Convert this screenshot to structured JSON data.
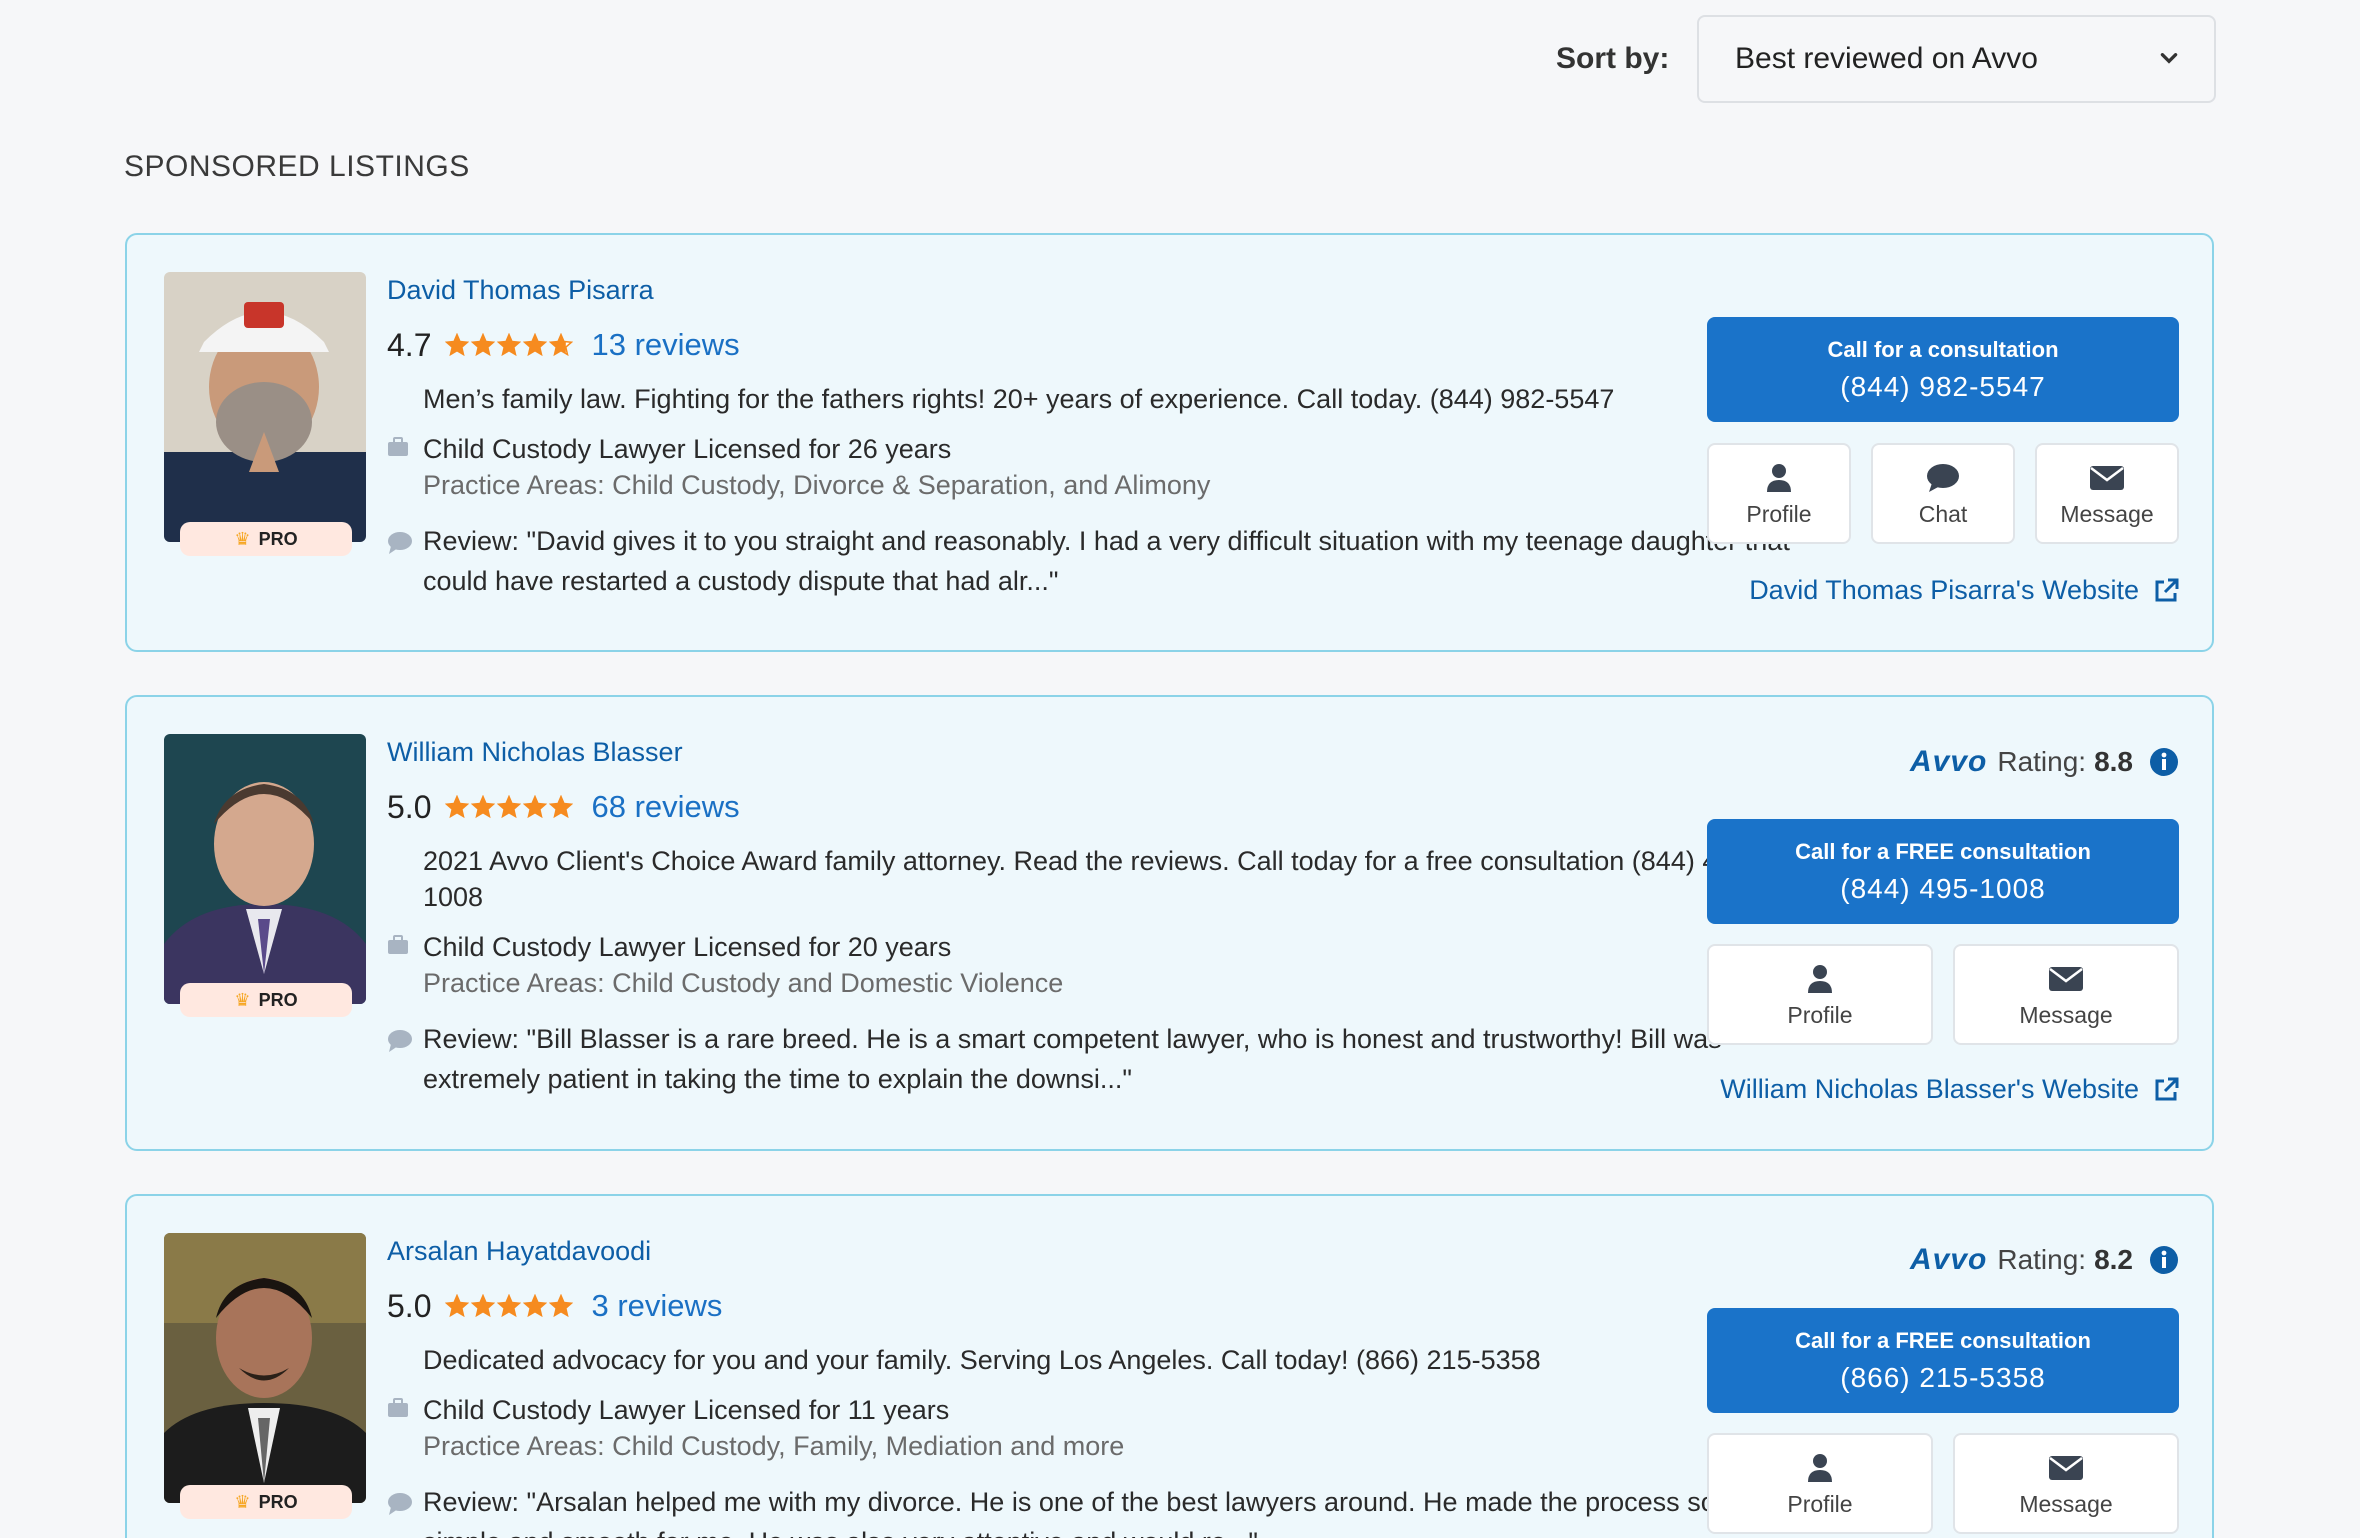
{
  "sort": {
    "label": "Sort by:",
    "selected": "Best reviewed on Avvo"
  },
  "section_title": "SPONSORED LISTINGS",
  "colors": {
    "brand_blue": "#1a73c9",
    "link_blue": "#0d5ea6",
    "card_bg": "#eef8fc",
    "card_border": "#8bd3e8",
    "star": "#f68b1f"
  },
  "listings": [
    {
      "name": "David Thomas Pisarra",
      "score": "4.7",
      "stars": 4.7,
      "reviews": "13 reviews",
      "badge": "PRO",
      "tagline": "Men’s family law. Fighting for the fathers rights! 20+ years of experience. Call today. (844) 982-5547",
      "license": "Child Custody Lawyer Licensed for 26 years",
      "practice": "Practice Areas: Child Custody, Divorce & Separation, and Alimony",
      "review": "Review: \"David gives it to you straight and reasonably. I had a very difficult situation with my teenage daughter that could have restarted a custody dispute that had alr...\"",
      "call_title": "Call for a consultation",
      "call_phone": "(844) 982-5547",
      "actions": [
        "Profile",
        "Chat",
        "Message"
      ],
      "website": "David Thomas Pisarra's Website"
    },
    {
      "name": "William Nicholas Blasser",
      "score": "5.0",
      "stars": 5,
      "reviews": "68 reviews",
      "badge": "PRO",
      "avvo_logo": "Avvo",
      "avvo_label": "Rating:",
      "avvo_rating": "8.8",
      "tagline": "2021 Avvo Client's Choice Award family attorney. Read the reviews. Call today for a free consultation (844) 495-1008",
      "license": "Child Custody Lawyer Licensed for 20 years",
      "practice": "Practice Areas: Child Custody and Domestic Violence",
      "review": "Review: \"Bill Blasser is a rare breed. He is a smart competent lawyer, who is honest and trustworthy! Bill was extremely patient in taking the time to explain the downsi...\"",
      "call_title": "Call for a FREE consultation",
      "call_phone": "(844) 495-1008",
      "actions": [
        "Profile",
        "Message"
      ],
      "website": "William Nicholas Blasser's Website"
    },
    {
      "name": "Arsalan Hayatdavoodi",
      "score": "5.0",
      "stars": 5,
      "reviews": "3 reviews",
      "badge": "PRO",
      "avvo_logo": "Avvo",
      "avvo_label": "Rating:",
      "avvo_rating": "8.2",
      "tagline": "Dedicated advocacy for you and your family. Serving Los Angeles. Call today! (866) 215-5358",
      "license": "Child Custody Lawyer Licensed for 11 years",
      "practice": "Practice Areas: Child Custody, Family, Mediation and more",
      "review": "Review: \"Arsalan helped me with my divorce. He is one of the best lawyers around. He made the process so simple and smooth for me. He was also very attentive and would re...\"",
      "call_title": "Call for a FREE consultation",
      "call_phone": "(866) 215-5358",
      "actions": [
        "Profile",
        "Message"
      ]
    }
  ]
}
